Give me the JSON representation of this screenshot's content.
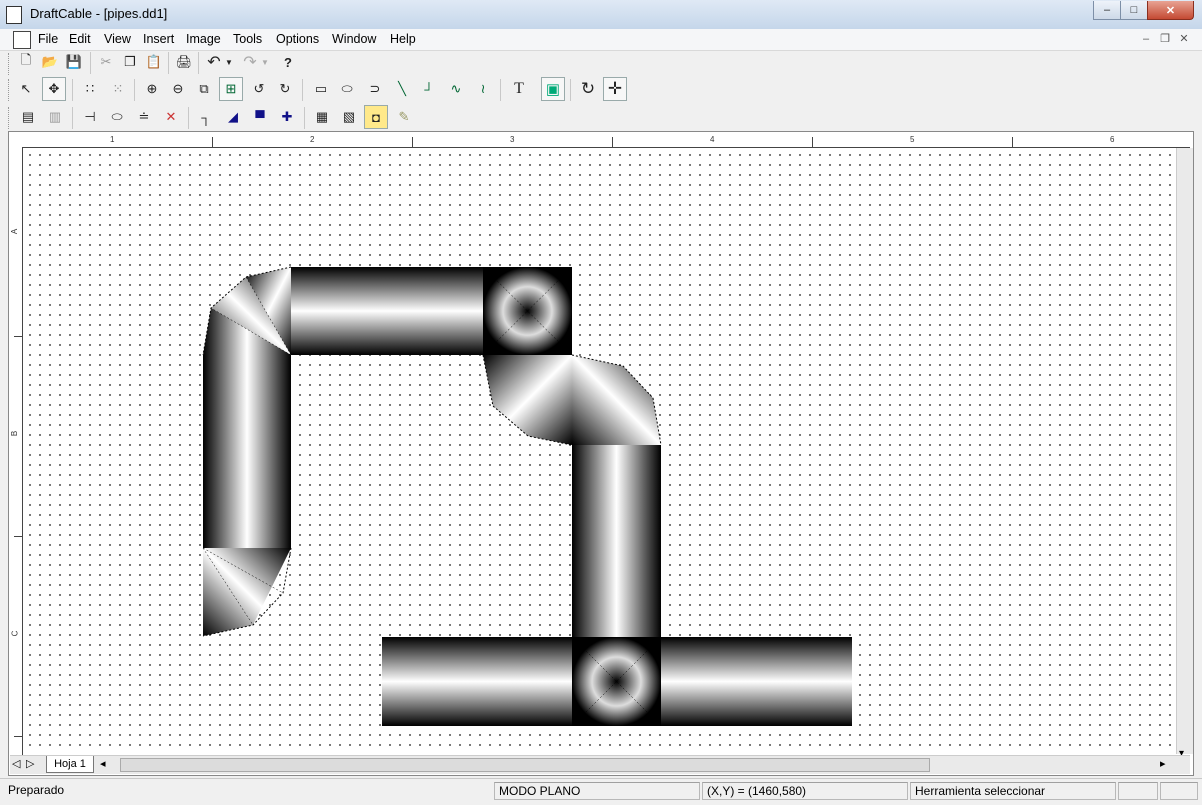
{
  "window": {
    "title": "DraftCable - [pipes.dd1]",
    "buttons": {
      "minimize": "–",
      "maximize": "□",
      "close": "✕"
    }
  },
  "menubar": {
    "items": [
      {
        "label": "File"
      },
      {
        "label": "Edit"
      },
      {
        "label": "View"
      },
      {
        "label": "Insert"
      },
      {
        "label": "Image"
      },
      {
        "label": "Tools"
      },
      {
        "label": "Options"
      },
      {
        "label": "Window"
      },
      {
        "label": "Help"
      }
    ],
    "mdi_buttons": {
      "minimize": "–",
      "restore": "❐",
      "close": "✕"
    }
  },
  "toolbar1": {
    "icons": {
      "new": "🗋",
      "open": "📂",
      "save": "💾",
      "cut": "✂",
      "copy": "❐",
      "paste": "📋",
      "print": "🖨",
      "undo": "↶",
      "redo": "↷",
      "help": "?"
    }
  },
  "toolbar2": {
    "icons": {
      "select": "↖",
      "move": "✥",
      "grid-dots": "∷",
      "grid-fine": "⁙",
      "zoom-in": "⊕",
      "zoom-out": "⊖",
      "zoom-window": "⧉",
      "zoom-fit": "⊞",
      "pan-left": "↺",
      "pan-right": "↻",
      "rectangle": "▭",
      "ellipse": "⬭",
      "arc": "⊃",
      "line": "╲",
      "polyline": "┘",
      "curve": "∿",
      "spline": "≀",
      "text": "T",
      "image": "▣",
      "rotate": "↻",
      "move-cross": "✛"
    }
  },
  "toolbar3": {
    "icons": {
      "component-a": "▤",
      "component-b": "▥",
      "terminal": "⊣",
      "ellipse-connector": "⬭",
      "fish-connector": "≐",
      "cross-delete": "✕",
      "step-line": "┐",
      "slope-line": "◢",
      "step-blue": "▀",
      "node": "✚",
      "sheet-a": "▦",
      "sheet-b": "▧",
      "camera": "◘",
      "pen": "✎"
    }
  },
  "ruler": {
    "top": [
      "1",
      "2",
      "3",
      "4",
      "5",
      "6"
    ],
    "left": [
      "A",
      "B",
      "C"
    ]
  },
  "sheet_tabs": {
    "nav": [
      "◁",
      "▷"
    ],
    "active": "Hoja 1"
  },
  "scroll": {
    "left": "◂",
    "right": "▸",
    "up": "▴",
    "down": "▾"
  },
  "statusbar": {
    "status": "Preparado",
    "mode": "MODO PLANO",
    "coords": "(X,Y) = (1460,580)",
    "tool": "Herramienta seleccionar"
  }
}
